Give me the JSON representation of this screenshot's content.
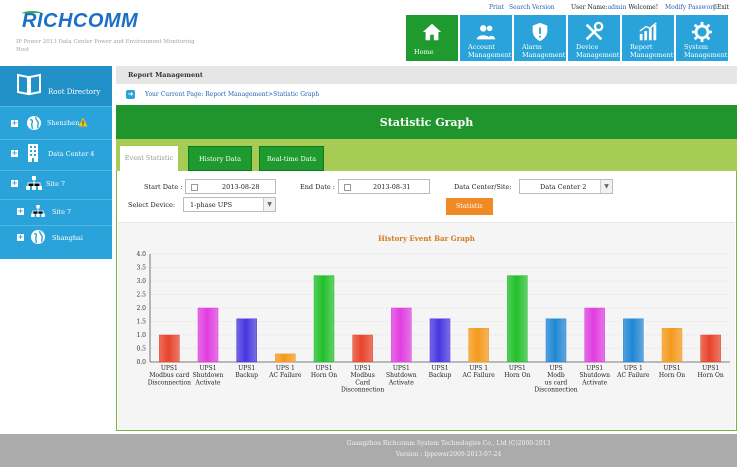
{
  "header": {
    "logo_text": "RICHCOMM",
    "subtitle": "IP Power 2013 Data Center Power and Environment Monitoring Host",
    "links": [
      "Print",
      "Search",
      "Version"
    ],
    "user_prefix": "User Name:",
    "user_name": "admin",
    "welcome": "Welcome!",
    "modify_password": "Modify Password",
    "exit": "Exit"
  },
  "nav": [
    {
      "label": "Home",
      "icon": "home-icon"
    },
    {
      "label": "Account Management",
      "icon": "users-icon"
    },
    {
      "label": "Alarm Management",
      "icon": "shield-alarm-icon"
    },
    {
      "label": "Device Management",
      "icon": "tools-icon"
    },
    {
      "label": "Report Management",
      "icon": "bar-chart-icon"
    },
    {
      "label": "System Management",
      "icon": "gear-icon"
    }
  ],
  "sidebar": {
    "root": "Root Directory",
    "items": [
      {
        "label": "Shenzhen",
        "icon": "globe-icon",
        "warning": true
      },
      {
        "label": "Data Center 4",
        "icon": "building-icon"
      },
      {
        "label": "Site 7",
        "icon": "network-icon"
      },
      {
        "label": "Site 7",
        "icon": "network-icon"
      },
      {
        "label": "Shanghai",
        "icon": "globe-icon"
      }
    ]
  },
  "page": {
    "section": "Report Management",
    "breadcrumb": "Your Current Page: Report Management>Statistic Graph",
    "title": "Statistic Graph",
    "tabs": [
      "Event Statistic",
      "History Data",
      "Real-time Data"
    ]
  },
  "form": {
    "start_date_label": "Start Date :",
    "start_date": "2013-08-28",
    "end_date_label": "End Date :",
    "end_date": "2013-08-31",
    "site_label": "Data Center/Site:",
    "site_value": "Data Center 2",
    "device_label": "Select Device:",
    "device_value": "1-phase UPS",
    "submit_label": "Statistic"
  },
  "chart_data": {
    "type": "bar",
    "title": "History Event Bar Graph",
    "ylim": [
      0,
      4
    ],
    "yticks": [
      "0.0",
      "0.5",
      "1.0",
      "1.5",
      "2.0",
      "2.5",
      "3.0",
      "3.5",
      "4.0"
    ],
    "categories": [
      "UPS1 Modbus card Disconnection",
      "UPS1 Shutdown Activate",
      "UPS1 Backup",
      "UPS 1 AC Failure",
      "UPS1 Horn On",
      "UPS1 Modbus Card Disconnection",
      "UPS1 Shutdown Activate",
      "UPS1 Backup",
      "UPS 1 AC Failure",
      "UPS1 Horn On",
      "UPS Modbus card Disconnection",
      "UPS1 Shutdown Activate",
      "UPS 1 AC Failure",
      "UPS1 Horn On",
      "UPS1 Horn On"
    ],
    "category_lines": [
      [
        "UPS1",
        "Modbus card",
        "Disconnection"
      ],
      [
        "UPS1",
        "Shutdown",
        "Activate"
      ],
      [
        "UPS1",
        "Backup"
      ],
      [
        "UPS 1",
        "AC Failure"
      ],
      [
        "UPS1",
        "Horn On"
      ],
      [
        "UPS1",
        "Modbus",
        "Card",
        "Disconnection"
      ],
      [
        "UPS1",
        "Shutdown",
        "Activate"
      ],
      [
        "UPS1",
        "Backup"
      ],
      [
        "UPS 1",
        "AC Failure"
      ],
      [
        "UPS1",
        "Horn On"
      ],
      [
        "UPS",
        "Modb",
        "us card",
        "Disconnection"
      ],
      [
        "UPS1",
        "Shutdown",
        "Activate"
      ],
      [
        "UPS 1",
        "AC Failure"
      ],
      [
        "UPS1",
        "Horn On"
      ],
      [
        "UPS1",
        "Horn On"
      ]
    ],
    "values": [
      1,
      2,
      1.6,
      0.3,
      3.2,
      1,
      2,
      1.6,
      1.25,
      3.2,
      1.6,
      2,
      1.6,
      1.25,
      1
    ],
    "colors": [
      "#e8442a",
      "#e03de0",
      "#4836e0",
      "#f59a1c",
      "#22c02a",
      "#e8442a",
      "#e03de0",
      "#4836e0",
      "#f59a1c",
      "#22c02a",
      "#1f86d4",
      "#e03de0",
      "#1f86d4",
      "#f59a1c",
      "#e8442a"
    ],
    "grid": true
  },
  "footer": {
    "company": "Guangzhou Richcomm System Technologies Co., Ltd (C)2000-2013",
    "version": "Version : Ippower2009-2013-07-24"
  }
}
